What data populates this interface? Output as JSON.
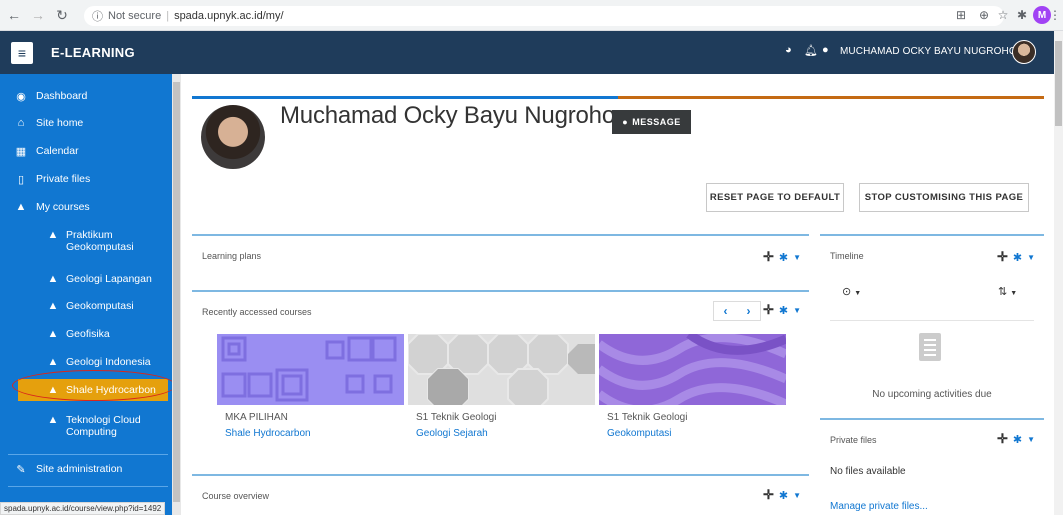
{
  "browser": {
    "security_label": "Not secure",
    "url": "spada.upnyk.ac.id/my/",
    "profile_initial": "M"
  },
  "navbar": {
    "brand": "E-LEARNING",
    "username": "MUCHAMAD OCKY BAYU NUGROHO"
  },
  "sidebar": {
    "items": [
      {
        "label": "Dashboard",
        "icon": "tachometer-icon"
      },
      {
        "label": "Site home",
        "icon": "home-icon"
      },
      {
        "label": "Calendar",
        "icon": "calendar-icon"
      },
      {
        "label": "Private files",
        "icon": "file-icon"
      },
      {
        "label": "My courses",
        "icon": "graduation-cap-icon"
      },
      {
        "label": "Praktikum Geokomputasi",
        "icon": "graduation-cap-icon"
      },
      {
        "label": "Geologi Lapangan",
        "icon": "graduation-cap-icon"
      },
      {
        "label": "Geokomputasi",
        "icon": "graduation-cap-icon"
      },
      {
        "label": "Geofisika",
        "icon": "graduation-cap-icon"
      },
      {
        "label": "Geologi Indonesia",
        "icon": "graduation-cap-icon"
      },
      {
        "label": "Shale Hydrocarbon",
        "icon": "graduation-cap-icon"
      },
      {
        "label": "Teknologi Cloud Computing",
        "icon": "graduation-cap-icon"
      },
      {
        "label": "Site administration",
        "icon": "wrench-icon"
      }
    ],
    "highlight_color": "#e5a00d",
    "background_color": "#1177d1"
  },
  "header": {
    "title": "Muchamad Ocky Bayu Nugroho",
    "message_label": "MESSAGE",
    "reset_label": "RESET PAGE TO DEFAULT",
    "stop_label": "STOP CUSTOMISING THIS PAGE"
  },
  "blocks": {
    "learning_plans": "Learning plans",
    "recently_accessed": "Recently accessed courses",
    "course_overview": "Course overview",
    "timeline": {
      "title": "Timeline",
      "empty": "No upcoming activities due"
    },
    "private_files": {
      "title": "Private files",
      "empty": "No files available",
      "manage_link": "Manage private files..."
    }
  },
  "recent_courses": [
    {
      "category": "MKA PILIHAN",
      "name": "Shale Hydrocarbon"
    },
    {
      "category": "S1 Teknik Geologi",
      "name": "Geologi Sejarah"
    },
    {
      "category": "S1 Teknik Geologi",
      "name": "Geokomputasi"
    }
  ],
  "status_bar": {
    "url": "spada.upnyk.ac.id/course/view.php?id=1492"
  }
}
